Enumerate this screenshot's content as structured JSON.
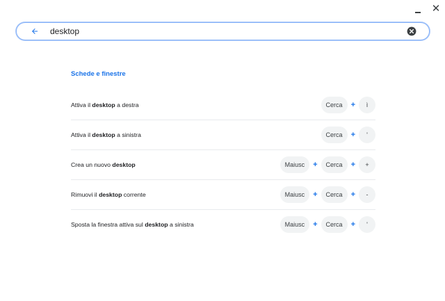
{
  "window": {
    "minimize_label": "minimize",
    "close_label": "close"
  },
  "search": {
    "value": "desktop",
    "back_icon": "arrow-back-icon",
    "clear_icon": "clear-circle-icon"
  },
  "section": {
    "title": "Schede e finestre"
  },
  "shortcuts": [
    {
      "pre": "Attiva il ",
      "bold": "desktop",
      "post": " a destra",
      "keys": [
        "Cerca",
        "ì"
      ]
    },
    {
      "pre": "Attiva il ",
      "bold": "desktop",
      "post": " a sinistra",
      "keys": [
        "Cerca",
        "'"
      ]
    },
    {
      "pre": "Crea un nuovo ",
      "bold": "desktop",
      "post": "",
      "keys": [
        "Maiusc",
        "Cerca",
        "+"
      ]
    },
    {
      "pre": "Rimuovi il ",
      "bold": "desktop",
      "post": " corrente",
      "keys": [
        "Maiusc",
        "Cerca",
        "-"
      ]
    },
    {
      "pre": "Sposta la finestra attiva sul ",
      "bold": "desktop",
      "post": " a sinistra",
      "keys": [
        "Maiusc",
        "Cerca",
        "'"
      ]
    }
  ],
  "colors": {
    "accent": "#1a73e8",
    "key_bg": "#f1f3f4",
    "divider": "#e8eaed"
  }
}
